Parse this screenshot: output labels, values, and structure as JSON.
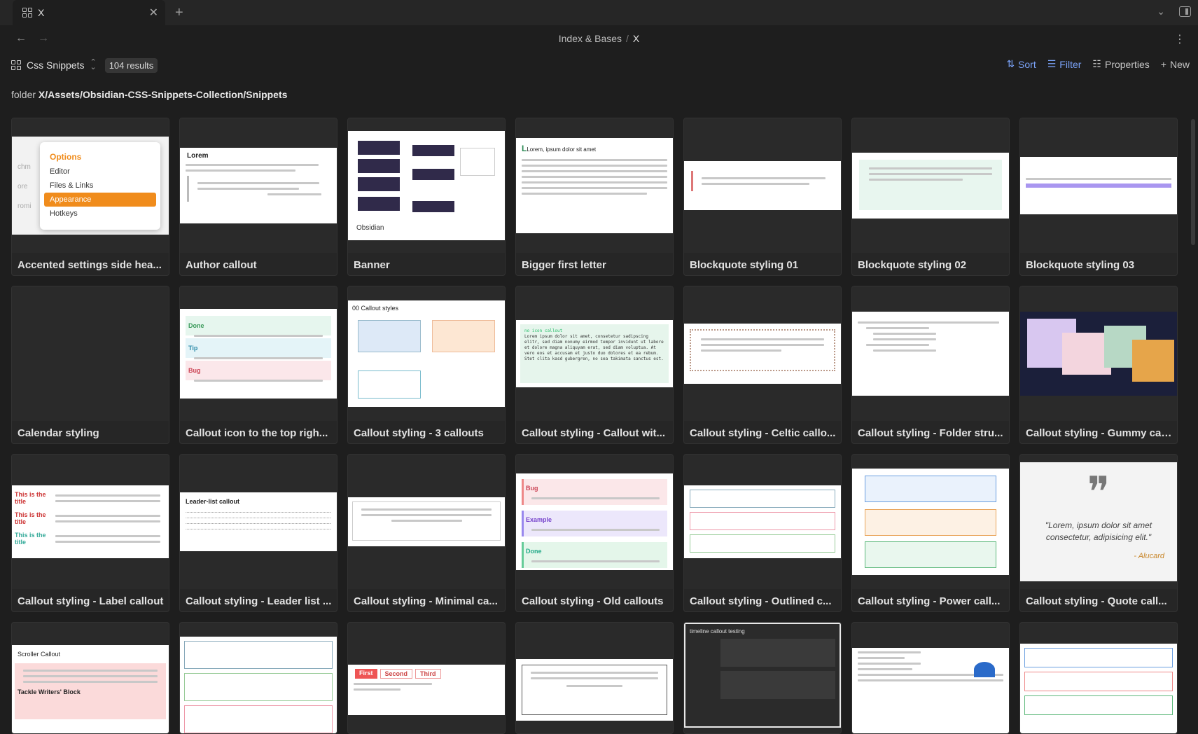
{
  "tab": {
    "title": "X"
  },
  "breadcrumb": {
    "parent": "Index & Bases",
    "separator": "/",
    "current": "X"
  },
  "toolbar": {
    "view_name": "Css Snippets",
    "results": "104 results",
    "sort_label": "Sort",
    "filter_label": "Filter",
    "properties_label": "Properties",
    "new_label": "New"
  },
  "filter": {
    "prefix": "folder",
    "path": "X/Assets/Obsidian-CSS-Snippets-Collection/Snippets"
  },
  "colors": {
    "accent": "#7aa2f7",
    "background": "#1e1e1e",
    "card": "#262626"
  },
  "thumb_text": {
    "settings_options": "Options",
    "settings_items": [
      "Editor",
      "Files & Links",
      "Appearance",
      "Hotkeys"
    ],
    "settings_side": [
      "chm",
      "ore",
      "romi"
    ],
    "author_title": "Lorem",
    "banner_brand": "Obsidian",
    "bigger_title": "Lorem, ipsum dolor sit amet",
    "callout_styles_title": "00 Callout styles",
    "noicon_title": "no icon callout",
    "noicon_body": "Lorem ipsum dolor sit amet, consetetur sadipscing elitr, sed diam nonumy eirmod tempor invidunt ut labore et dolore magna aliquyam erat, sed diam voluptua. At vero eos et accusam et justo duo dolores et ea rebum. Stet clita kasd gubergren, no sea takimata sanctus est.",
    "leader_title": "Leader-list callout",
    "quote_text": "\"Lorem, ipsum dolor sit amet consectetur, adipisicing elit.\"",
    "quote_author": "- Alucard",
    "scroller_title": "Scroller Callout",
    "scroller_footer": "Tackle Writers' Block",
    "timeline_title": "timeline callout testing",
    "tabs": [
      "First",
      "Second",
      "Third"
    ],
    "label_titles": [
      "This is the title",
      "This is the title",
      "This is the title"
    ],
    "icon_right": [
      "Done",
      "Tip",
      "Bug"
    ],
    "old_callouts": [
      "Bug",
      "Example",
      "Done"
    ]
  },
  "cards": [
    {
      "title": "Accented settings side hea..."
    },
    {
      "title": "Author callout"
    },
    {
      "title": "Banner"
    },
    {
      "title": "Bigger first letter"
    },
    {
      "title": "Blockquote styling 01"
    },
    {
      "title": "Blockquote styling 02"
    },
    {
      "title": "Blockquote styling 03"
    },
    {
      "title": "Calendar styling"
    },
    {
      "title": "Callout icon to the top righ..."
    },
    {
      "title": "Callout styling - 3 callouts"
    },
    {
      "title": "Callout styling - Callout wit..."
    },
    {
      "title": "Callout styling - Celtic callo..."
    },
    {
      "title": "Callout styling - Folder stru..."
    },
    {
      "title": "Callout styling - Gummy cal..."
    },
    {
      "title": "Callout styling - Label callout"
    },
    {
      "title": "Callout styling - Leader list ..."
    },
    {
      "title": "Callout styling - Minimal ca..."
    },
    {
      "title": "Callout styling - Old callouts"
    },
    {
      "title": "Callout styling - Outlined c..."
    },
    {
      "title": "Callout styling - Power call..."
    },
    {
      "title": "Callout styling - Quote call..."
    }
  ]
}
